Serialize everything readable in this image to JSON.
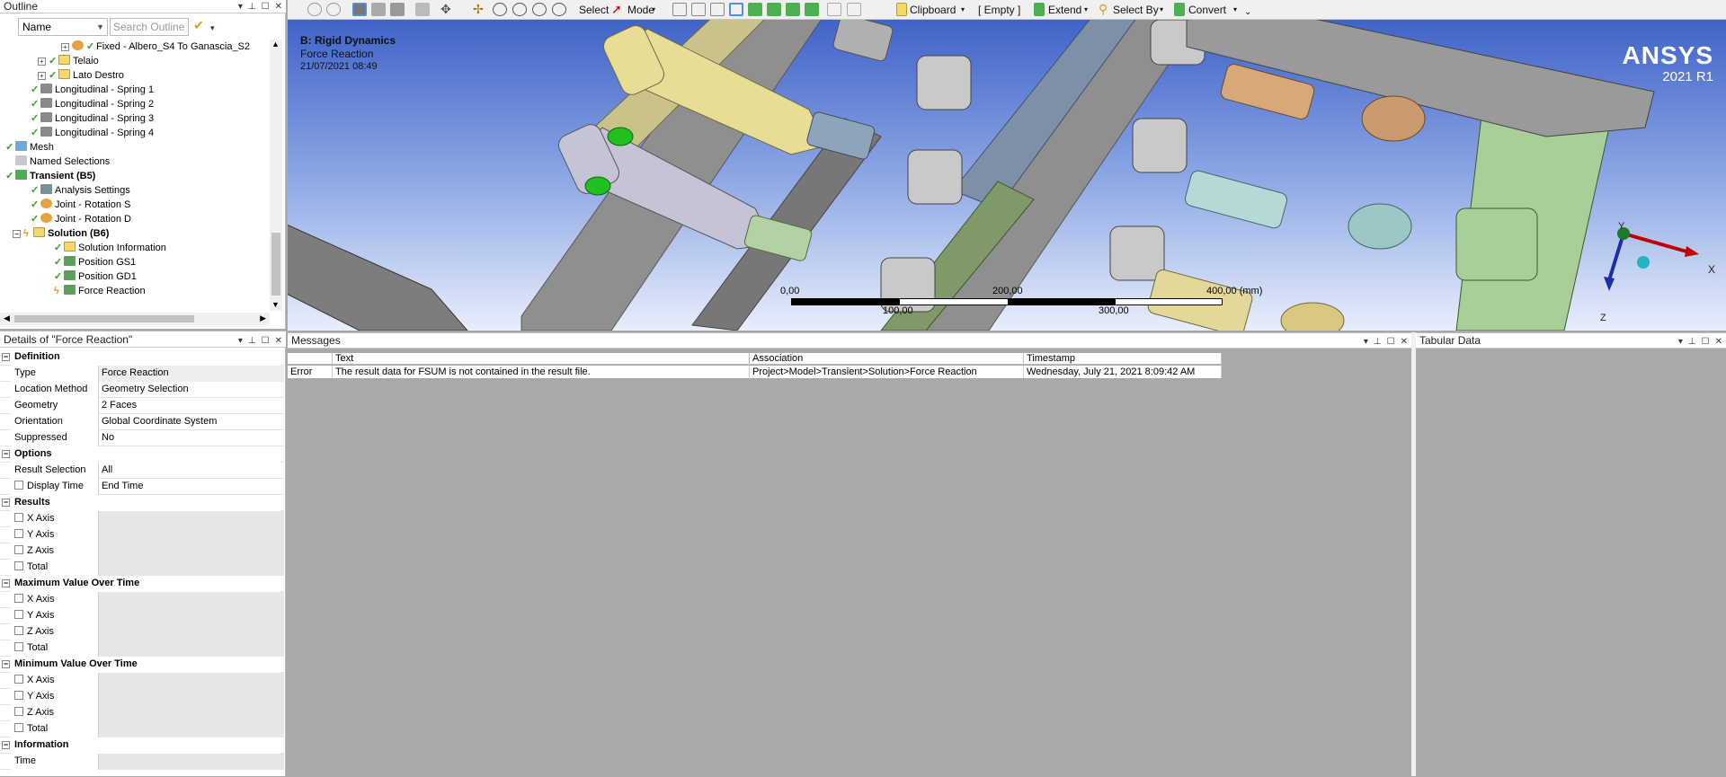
{
  "outline": {
    "title": "Outline",
    "name_filter": "Name",
    "search_placeholder": "Search Outline",
    "items": [
      {
        "label": "Fixed - Albero_S4 To Ganascia_S2"
      },
      {
        "label": "Telaio"
      },
      {
        "label": "Lato Destro"
      },
      {
        "label": "Longitudinal - Spring 1"
      },
      {
        "label": "Longitudinal - Spring 2"
      },
      {
        "label": "Longitudinal - Spring 3"
      },
      {
        "label": "Longitudinal - Spring 4"
      },
      {
        "label": "Mesh"
      },
      {
        "label": "Named Selections"
      },
      {
        "label": "Transient (B5)"
      },
      {
        "label": "Analysis Settings"
      },
      {
        "label": "Joint - Rotation S"
      },
      {
        "label": "Joint - Rotation D"
      },
      {
        "label": "Solution (B6)"
      },
      {
        "label": "Solution Information"
      },
      {
        "label": "Position GS1"
      },
      {
        "label": "Position GD1"
      },
      {
        "label": "Force Reaction"
      }
    ]
  },
  "toolbar": {
    "select_label": "Select",
    "mode_label": "Mode",
    "clipboard_label": "Clipboard",
    "empty_label": "[ Empty ]",
    "extend_label": "Extend",
    "select_by_label": "Select By",
    "convert_label": "Convert"
  },
  "viewport": {
    "analysis_title": "B: Rigid Dynamics",
    "result_name": "Force Reaction",
    "date": "21/07/2021 08:49",
    "brand": "ANSYS",
    "version": "2021 R1",
    "scale": {
      "t0": "0,00",
      "t200": "200,00",
      "t400": "400,00 (mm)",
      "t100": "100,00",
      "t300": "300,00"
    },
    "axes": {
      "x": "X",
      "y": "Y",
      "z": "Z"
    }
  },
  "details": {
    "title": "Details of \"Force Reaction\"",
    "definition_header": "Definition",
    "definition": [
      {
        "label": "Type",
        "value": "Force Reaction"
      },
      {
        "label": "Location Method",
        "value": "Geometry Selection"
      },
      {
        "label": "Geometry",
        "value": "2 Faces"
      },
      {
        "label": "Orientation",
        "value": "Global Coordinate System"
      },
      {
        "label": "Suppressed",
        "value": "No"
      }
    ],
    "options_header": "Options",
    "options": [
      {
        "label": "Result Selection",
        "value": "All"
      },
      {
        "label": "Display Time",
        "value": "End Time"
      }
    ],
    "results_header": "Results",
    "results": [
      {
        "label": "X Axis"
      },
      {
        "label": "Y Axis"
      },
      {
        "label": "Z Axis"
      },
      {
        "label": "Total"
      }
    ],
    "max_header": "Maximum Value Over Time",
    "max": [
      {
        "label": "X Axis"
      },
      {
        "label": "Y Axis"
      },
      {
        "label": "Z Axis"
      },
      {
        "label": "Total"
      }
    ],
    "min_header": "Minimum Value Over Time",
    "min": [
      {
        "label": "X Axis"
      },
      {
        "label": "Y Axis"
      },
      {
        "label": "Z Axis"
      },
      {
        "label": "Total"
      }
    ],
    "info_header": "Information",
    "info": [
      {
        "label": "Time"
      }
    ]
  },
  "messages": {
    "title": "Messages",
    "columns": {
      "text": "Text",
      "association": "Association",
      "timestamp": "Timestamp"
    },
    "row": {
      "level": "Error",
      "text": "The result data for FSUM is not contained in the result file.",
      "association": "Project>Model>Transient>Solution>Force Reaction",
      "timestamp": "Wednesday, July 21, 2021 8:09:42 AM"
    }
  },
  "tabular": {
    "title": "Tabular Data"
  },
  "colors": {
    "accent_green": "#2a9d2a",
    "toolbar_bg": "#f0f0f0",
    "viewport_top": "#3f63c8",
    "viewport_bottom": "#ffffff"
  }
}
